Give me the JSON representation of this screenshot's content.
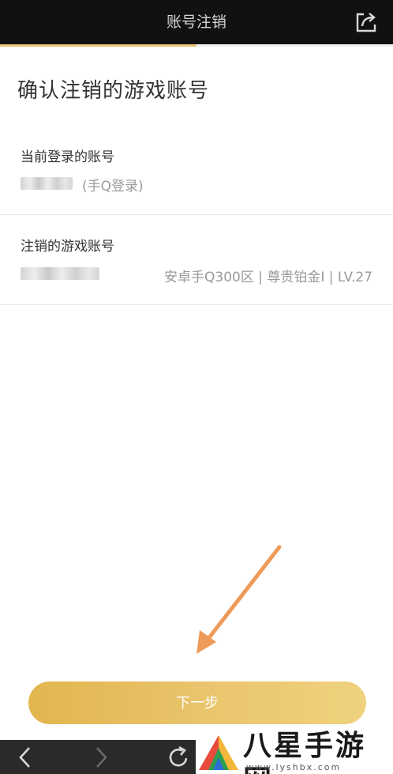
{
  "header": {
    "title": "账号注销",
    "progress": 0.5
  },
  "page": {
    "title": "确认注销的游戏账号"
  },
  "current_account": {
    "label": "当前登录的账号",
    "login_method": "(手Q登录)"
  },
  "game_account": {
    "label": "注销的游戏账号",
    "detail": "安卓手Q300区 | 尊贵铂金I | LV.27"
  },
  "actions": {
    "next_label": "下一步"
  },
  "watermark": {
    "name": "八星手游网",
    "url": "www.lyshbx.com"
  },
  "colors": {
    "accent": "#e8c474",
    "topbar": "#111111",
    "navbar": "#2a2a2a",
    "arrow": "#ee9a58"
  },
  "icons": {
    "share": "share-icon",
    "back": "back-icon",
    "forward": "forward-icon",
    "refresh": "refresh-icon"
  }
}
